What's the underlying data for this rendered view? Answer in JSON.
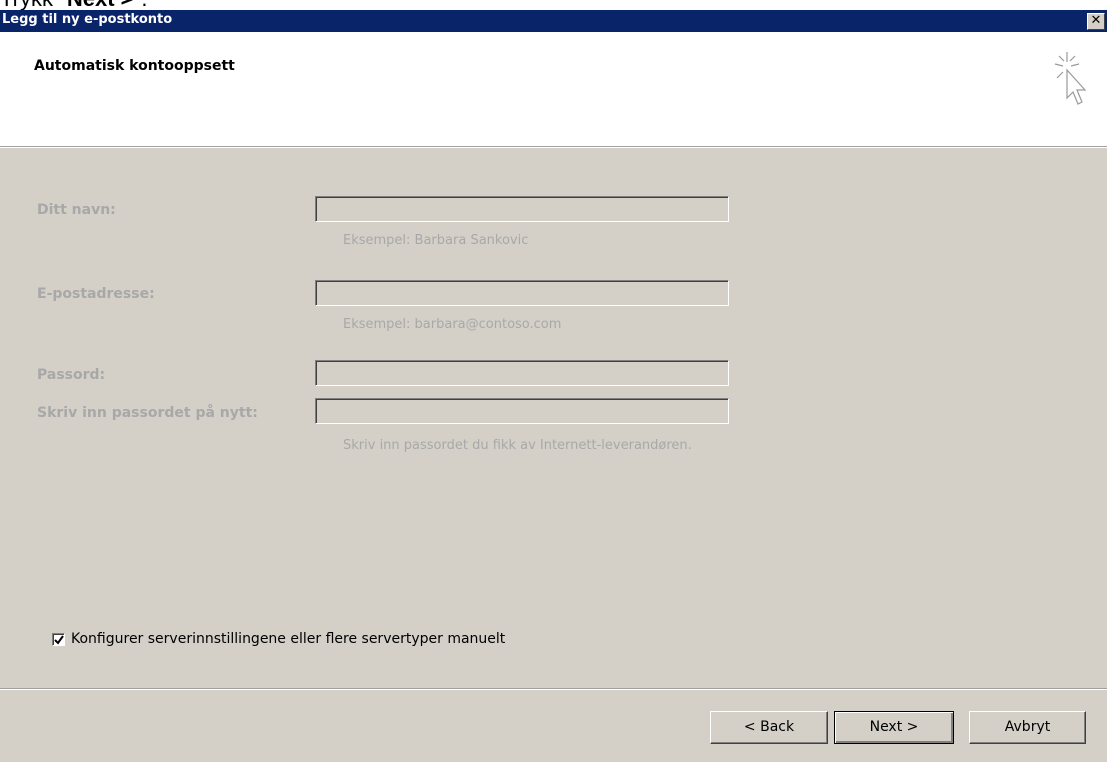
{
  "instruction": {
    "prefix": "Trykk \"",
    "bold": "Next >",
    "suffix": "\"."
  },
  "window": {
    "title": "Legg til ny e-postkonto",
    "close_glyph": "✕"
  },
  "header": {
    "heading": "Automatisk kontooppsett",
    "icon": "wizard-cursor-icon"
  },
  "form": {
    "name": {
      "label": "Ditt navn:",
      "value": "",
      "hint": "Eksempel: Barbara Sankovic"
    },
    "email": {
      "label": "E-postadresse:",
      "value": "",
      "hint": "Eksempel: barbara@contoso.com"
    },
    "password": {
      "label": "Passord:",
      "value": ""
    },
    "password_repeat": {
      "label": "Skriv inn passordet på nytt:",
      "value": "",
      "hint": "Skriv inn passordet du fikk av Internett-leverandøren."
    }
  },
  "manual_config": {
    "checked": true,
    "label": "Konfigurer serverinnstillingene eller flere servertyper manuelt"
  },
  "buttons": {
    "back": "< Back",
    "next": "Next >",
    "cancel": "Avbryt"
  },
  "colors": {
    "titlebar": "#0a246a",
    "dialog_bg": "#d4d0c8",
    "disabled_text": "#a8a8a8"
  }
}
